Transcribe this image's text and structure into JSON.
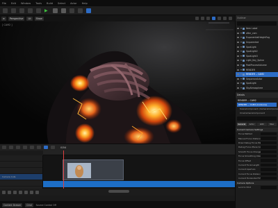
{
  "menubar": {
    "items": [
      "File",
      "Edit",
      "Window",
      "Tools",
      "Build",
      "Select",
      "Actor",
      "Help"
    ]
  },
  "viewport": {
    "camera_label": "[ CAM2 ]",
    "mode_label": "Perspective",
    "lit_label": "Lit",
    "show_label": "Show"
  },
  "outliner": {
    "title": "Outliner",
    "items": [
      {
        "label": "Item Label",
        "selected": false
      },
      {
        "label": "after_cam",
        "selected": false
      },
      {
        "label": "ExponentialHeightFog",
        "selected": false
      },
      {
        "label": "Unparented",
        "selected": false
      },
      {
        "label": "SpotLight",
        "selected": false
      },
      {
        "label": "SpotLight2",
        "selected": false
      },
      {
        "label": "SpotLight3",
        "selected": false
      },
      {
        "label": "Light_Key_Spline",
        "selected": false
      },
      {
        "label": "PostProcessVolume",
        "selected": false
      },
      {
        "label": "RENDER",
        "selected": false
      },
      {
        "label": "RENDER -- CAM2",
        "selected": true
      },
      {
        "label": "SequenceActor",
        "selected": false
      },
      {
        "label": "SpotLight",
        "selected": false
      },
      {
        "label": "SkyAtmosphere",
        "selected": false
      }
    ],
    "count_text": "14 actors (1 selected)"
  },
  "details": {
    "tab": "Details",
    "title": "RENDER -- CAM2",
    "selected_component": "RENDER -- CAM2 (Instance)",
    "sub_component": "SceneComponent (CameraComponent)",
    "sub_component2": "CineCameraComponent",
    "categories": [
      "General",
      "Actor",
      "LOD",
      "Misc"
    ],
    "active_category": "General",
    "sections": [
      {
        "title": "Current Camera Settings",
        "rows": [
          {
            "label": "Focus Method",
            "accent": false
          },
          {
            "label": "Manual Focus Distance",
            "accent": false
          },
          {
            "label": "Draw Debug Focus Plane",
            "accent": false
          },
          {
            "label": "Debug Focus Plane Color",
            "accent": false
          },
          {
            "label": "Smooth Focus Changes",
            "accent": false
          },
          {
            "label": "Focus Smoothing Interp",
            "accent": false
          },
          {
            "label": "Focus Offset",
            "accent": false
          },
          {
            "label": "Current Focal Length",
            "accent": false
          },
          {
            "label": "Current Aperture",
            "accent": false
          },
          {
            "label": "Current Focus Distance",
            "accent": false
          },
          {
            "label": "Current Horizontal FOV",
            "accent": false
          }
        ]
      },
      {
        "title": "Camera Options",
        "rows": [
          {
            "label": "Lock to Hmd",
            "accent": false
          }
        ]
      }
    ]
  },
  "sequencer": {
    "frame_text": "0154",
    "tracks": [
      "",
      "",
      "",
      "Camera Cuts",
      ""
    ],
    "status": {
      "chip1": "Content Drawer",
      "chip2": "Cmd",
      "text": "Source Control Off"
    }
  },
  "colors": {
    "accent": "#2d6cc6",
    "play": "#3fbf3f",
    "playhead": "#e04040",
    "glow": "#ff8a1a"
  }
}
